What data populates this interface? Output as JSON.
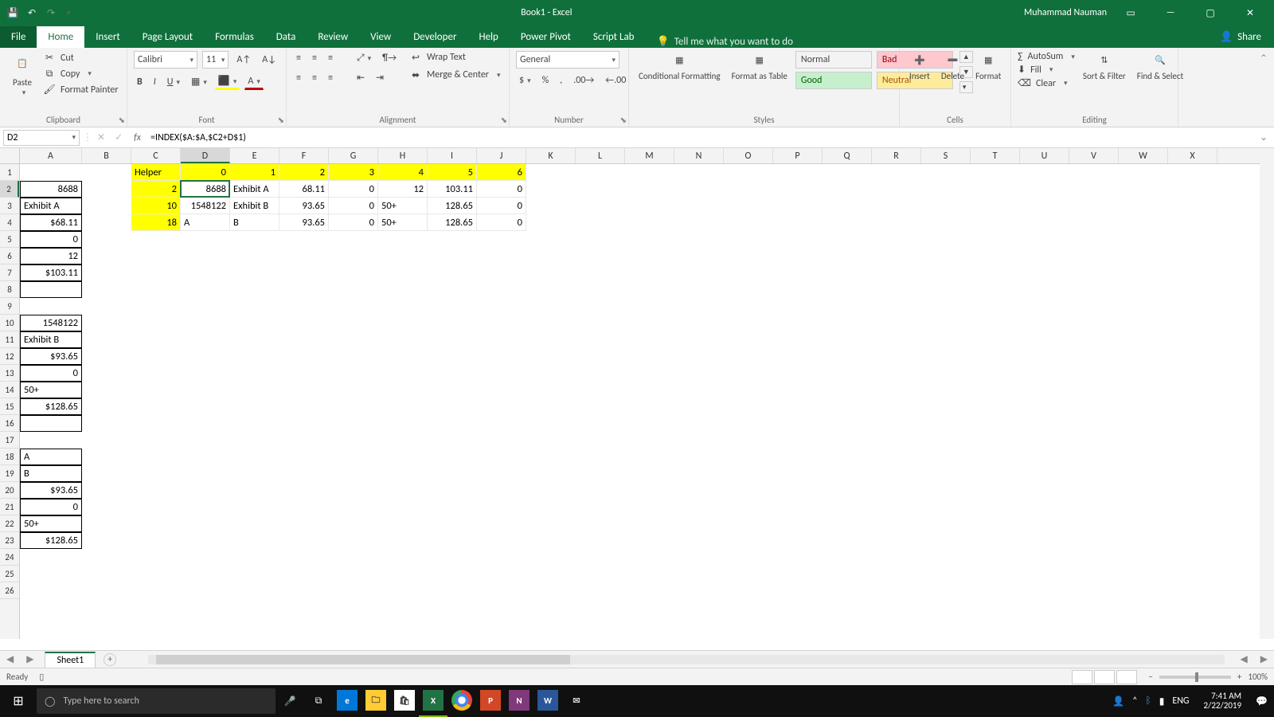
{
  "title": "Book1 - Excel",
  "user": "Muhammad Nauman",
  "tabs": [
    "File",
    "Home",
    "Insert",
    "Page Layout",
    "Formulas",
    "Data",
    "Review",
    "View",
    "Developer",
    "Help",
    "Power Pivot",
    "Script Lab"
  ],
  "tell_me": "Tell me what you want to do",
  "share": "Share",
  "clipboard": {
    "paste": "Paste",
    "cut": "Cut",
    "copy": "Copy",
    "fp": "Format Painter",
    "label": "Clipboard"
  },
  "font": {
    "name": "Calibri",
    "size": "11",
    "label": "Font"
  },
  "alignment": {
    "wrap": "Wrap Text",
    "merge": "Merge & Center",
    "label": "Alignment"
  },
  "number": {
    "format": "General",
    "label": "Number"
  },
  "styles": {
    "cf": "Conditional Formatting",
    "fat": "Format as Table",
    "s1": "Normal",
    "s2": "Bad",
    "s3": "Good",
    "s4": "Neutral",
    "label": "Styles"
  },
  "cellsgrp": {
    "insert": "Insert",
    "delete": "Delete",
    "format": "Format",
    "label": "Cells"
  },
  "editing": {
    "sum": "AutoSum",
    "fill": "Fill",
    "clear": "Clear",
    "sort": "Sort & Filter",
    "find": "Find & Select",
    "label": "Editing"
  },
  "namebox": "D2",
  "formula": "=INDEX($A:$A,$C2+D$1)",
  "columns": [
    "A",
    "B",
    "C",
    "D",
    "E",
    "F",
    "G",
    "H",
    "I",
    "J",
    "K",
    "L",
    "M",
    "N",
    "O",
    "P",
    "Q",
    "R",
    "S",
    "T",
    "U",
    "V",
    "W",
    "X"
  ],
  "col_widths": {
    "A": 78,
    "default": 62
  },
  "row_count": 26,
  "active": {
    "col": "D",
    "row": 2
  },
  "cells_data": [
    {
      "r": 1,
      "c": "C",
      "v": "Helper",
      "hl": true,
      "align": "l"
    },
    {
      "r": 1,
      "c": "D",
      "v": "0",
      "hl": true,
      "align": "r"
    },
    {
      "r": 1,
      "c": "E",
      "v": "1",
      "hl": true,
      "align": "r"
    },
    {
      "r": 1,
      "c": "F",
      "v": "2",
      "hl": true,
      "align": "r"
    },
    {
      "r": 1,
      "c": "G",
      "v": "3",
      "hl": true,
      "align": "r"
    },
    {
      "r": 1,
      "c": "H",
      "v": "4",
      "hl": true,
      "align": "r"
    },
    {
      "r": 1,
      "c": "I",
      "v": "5",
      "hl": true,
      "align": "r"
    },
    {
      "r": 1,
      "c": "J",
      "v": "6",
      "hl": true,
      "align": "r"
    },
    {
      "r": 2,
      "c": "A",
      "v": "8688",
      "align": "r",
      "thick": true
    },
    {
      "r": 2,
      "c": "C",
      "v": "2",
      "hl": true,
      "align": "r"
    },
    {
      "r": 2,
      "c": "D",
      "v": "8688",
      "align": "r"
    },
    {
      "r": 2,
      "c": "E",
      "v": "Exhibit A",
      "align": "l"
    },
    {
      "r": 2,
      "c": "F",
      "v": "68.11",
      "align": "r"
    },
    {
      "r": 2,
      "c": "G",
      "v": "0",
      "align": "r"
    },
    {
      "r": 2,
      "c": "H",
      "v": "12",
      "align": "r"
    },
    {
      "r": 2,
      "c": "I",
      "v": "103.11",
      "align": "r"
    },
    {
      "r": 2,
      "c": "J",
      "v": "0",
      "align": "r"
    },
    {
      "r": 3,
      "c": "A",
      "v": "Exhibit A",
      "align": "l",
      "thick": true
    },
    {
      "r": 3,
      "c": "C",
      "v": "10",
      "hl": true,
      "align": "r"
    },
    {
      "r": 3,
      "c": "D",
      "v": "1548122",
      "align": "r"
    },
    {
      "r": 3,
      "c": "E",
      "v": "Exhibit B",
      "align": "l"
    },
    {
      "r": 3,
      "c": "F",
      "v": "93.65",
      "align": "r"
    },
    {
      "r": 3,
      "c": "G",
      "v": "0",
      "align": "r"
    },
    {
      "r": 3,
      "c": "H",
      "v": "50+",
      "align": "l"
    },
    {
      "r": 3,
      "c": "I",
      "v": "128.65",
      "align": "r"
    },
    {
      "r": 3,
      "c": "J",
      "v": "0",
      "align": "r"
    },
    {
      "r": 4,
      "c": "A",
      "v": "$68.11",
      "align": "r",
      "thick": true
    },
    {
      "r": 4,
      "c": "C",
      "v": "18",
      "hl": true,
      "align": "r"
    },
    {
      "r": 4,
      "c": "D",
      "v": "A",
      "align": "l"
    },
    {
      "r": 4,
      "c": "E",
      "v": "B",
      "align": "l"
    },
    {
      "r": 4,
      "c": "F",
      "v": "93.65",
      "align": "r"
    },
    {
      "r": 4,
      "c": "G",
      "v": "0",
      "align": "r"
    },
    {
      "r": 4,
      "c": "H",
      "v": "50+",
      "align": "l"
    },
    {
      "r": 4,
      "c": "I",
      "v": "128.65",
      "align": "r"
    },
    {
      "r": 4,
      "c": "J",
      "v": "0",
      "align": "r"
    },
    {
      "r": 5,
      "c": "A",
      "v": "0",
      "align": "r",
      "thick": true
    },
    {
      "r": 6,
      "c": "A",
      "v": "12",
      "align": "r",
      "thick": true
    },
    {
      "r": 7,
      "c": "A",
      "v": "$103.11",
      "align": "r",
      "thick": true
    },
    {
      "r": 8,
      "c": "A",
      "v": "",
      "align": "r",
      "thick": true
    },
    {
      "r": 10,
      "c": "A",
      "v": "1548122",
      "align": "r",
      "thick": true
    },
    {
      "r": 11,
      "c": "A",
      "v": "Exhibit B",
      "align": "l",
      "thick": true
    },
    {
      "r": 12,
      "c": "A",
      "v": "$93.65",
      "align": "r",
      "thick": true
    },
    {
      "r": 13,
      "c": "A",
      "v": "0",
      "align": "r",
      "thick": true
    },
    {
      "r": 14,
      "c": "A",
      "v": "50+",
      "align": "l",
      "thick": true
    },
    {
      "r": 15,
      "c": "A",
      "v": "$128.65",
      "align": "r",
      "thick": true
    },
    {
      "r": 16,
      "c": "A",
      "v": "",
      "align": "r",
      "thick": true
    },
    {
      "r": 18,
      "c": "A",
      "v": "A",
      "align": "l",
      "thick": true
    },
    {
      "r": 19,
      "c": "A",
      "v": "B",
      "align": "l",
      "thick": true
    },
    {
      "r": 20,
      "c": "A",
      "v": "$93.65",
      "align": "r",
      "thick": true
    },
    {
      "r": 21,
      "c": "A",
      "v": "0",
      "align": "r",
      "thick": true
    },
    {
      "r": 22,
      "c": "A",
      "v": "50+",
      "align": "l",
      "thick": true
    },
    {
      "r": 23,
      "c": "A",
      "v": "$128.65",
      "align": "r",
      "thick": true
    }
  ],
  "sheet_tab": "Sheet1",
  "status": {
    "ready": "Ready",
    "zoom": "100%"
  },
  "taskbar": {
    "search": "Type here to search",
    "lang": "ENG",
    "time": "7:41 AM",
    "date": "2/22/2019"
  }
}
